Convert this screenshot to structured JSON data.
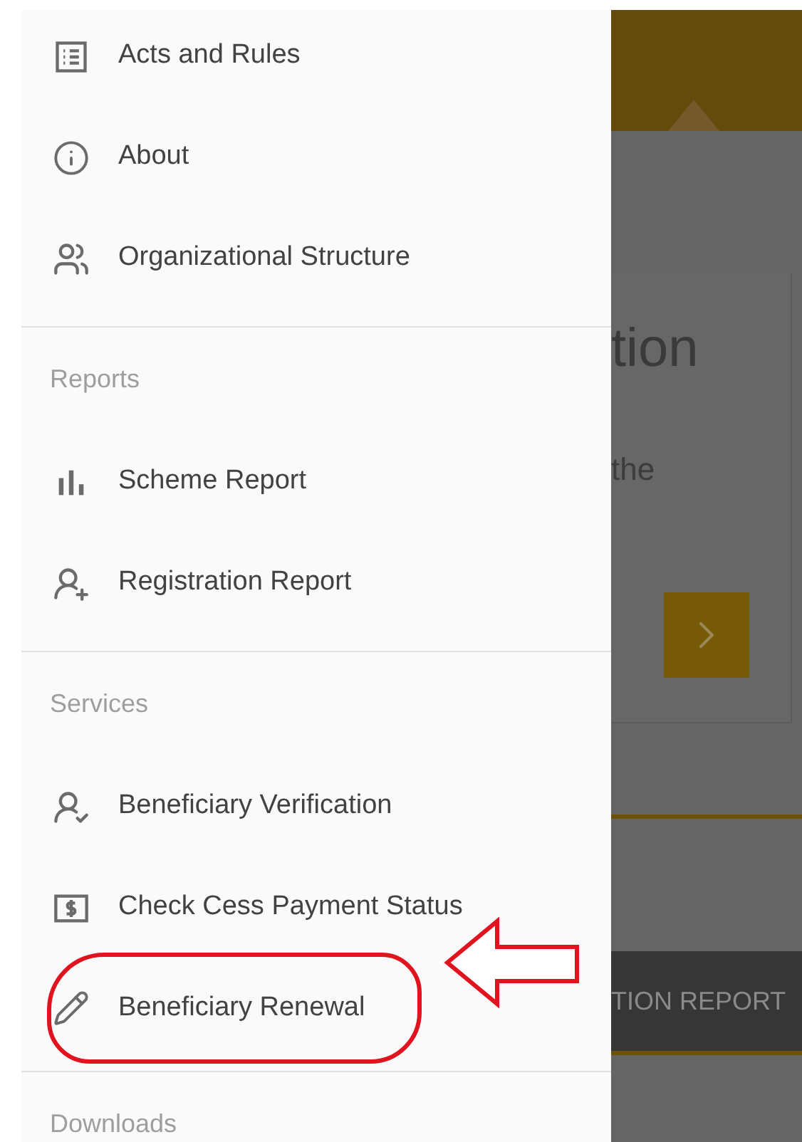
{
  "drawer": {
    "sections": [
      {
        "items": [
          {
            "label": "Acts and Rules",
            "kind": "list",
            "highlighted": false
          },
          {
            "label": "About",
            "kind": "info",
            "highlighted": false
          },
          {
            "label": "Organizational Structure",
            "kind": "people",
            "highlighted": false
          }
        ]
      },
      {
        "heading": "Reports",
        "items": [
          {
            "label": "Scheme Report",
            "kind": "bars",
            "highlighted": false
          },
          {
            "label": "Registration Report",
            "kind": "add-person",
            "highlighted": false
          }
        ]
      },
      {
        "heading": "Services",
        "items": [
          {
            "label": "Beneficiary Verification",
            "kind": "verify-person",
            "highlighted": false
          },
          {
            "label": "Check Cess Payment Status",
            "kind": "money",
            "highlighted": false
          },
          {
            "label": "Beneficiary Renewal",
            "kind": "pencil",
            "highlighted": true
          }
        ]
      },
      {
        "heading": "Downloads"
      }
    ]
  },
  "background": {
    "card_title": "tion",
    "card_text": "the",
    "bar_label": "TION REPORT"
  }
}
